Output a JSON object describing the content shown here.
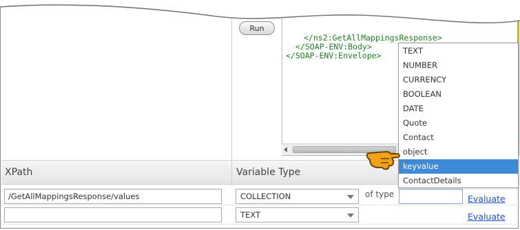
{
  "run_button": {
    "label": "Run"
  },
  "xml_pane": {
    "lines": [
      "</ns2:GetAllMappingsResponse>",
      "</SOAP-ENV:Body>",
      "</SOAP-ENV:Envelope>"
    ],
    "text_color": "#1f7f1f"
  },
  "table": {
    "headers": {
      "xpath": "XPath",
      "variable_type": "Variable Type"
    },
    "rows": [
      {
        "xpath": "/GetAllMappingsResponse/values",
        "type": "COLLECTION",
        "of_type": "of type",
        "evaluate": "Evaluate"
      },
      {
        "xpath": "",
        "type": "TEXT",
        "evaluate": "Evaluate"
      }
    ]
  },
  "dropdown": {
    "items": [
      "TEXT",
      "NUMBER",
      "CURRENCY",
      "BOOLEAN",
      "DATE",
      "Quote",
      "Contact",
      "object",
      "keyvalue",
      "ContactDetails"
    ],
    "selected": "keyvalue",
    "highlight_color": "#3d8ad9"
  },
  "icons": {
    "pointer": "pointing-hand-icon"
  },
  "colors": {
    "link": "#1a4fd0",
    "accent": "#f0a318"
  }
}
